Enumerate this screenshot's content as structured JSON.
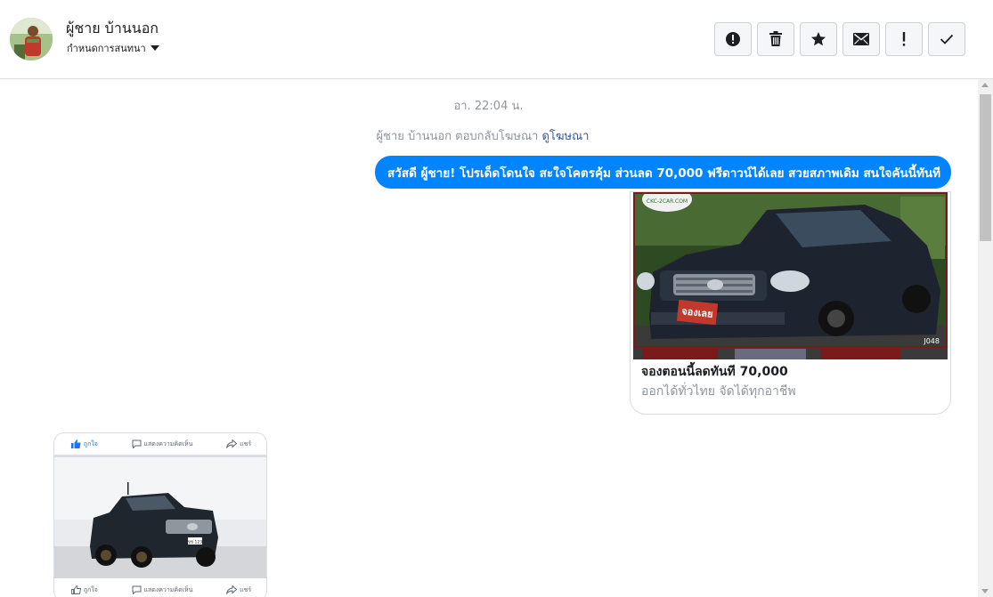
{
  "header": {
    "contact_name": "ผู้ชาย บ้านนอก",
    "conversation_settings": "กำหนดการสนทนา",
    "actions": [
      {
        "icon": "alert-circle-icon",
        "label": "report"
      },
      {
        "icon": "trash-icon",
        "label": "delete"
      },
      {
        "icon": "star-icon",
        "label": "star"
      },
      {
        "icon": "envelope-icon",
        "label": "mark-unread"
      },
      {
        "icon": "exclamation-icon",
        "label": "spam"
      },
      {
        "icon": "check-icon",
        "label": "done"
      }
    ]
  },
  "thread": {
    "timestamp": "อา. 22:04 น.",
    "ad_reply_text": "ผู้ชาย บ้านนอก ตอบกลับโฆษณา",
    "ad_reply_link": "ดูโฆษณา",
    "message": "สวัสดี ผู้ชาย! โปรเด็ดโดนใจ สะใจโคตรคุ้ม ส่วนลด 70,000 ฟรีดาวน์ได้เลย สวยสภาพเดิม สนใจคันนี้ทันที",
    "ad_card": {
      "title": "จองตอนนี้ลดทันที 70,000",
      "subtitle": "ออกได้ทั่วไทย จัดได้ทุกอาชีพ",
      "image_badge": "จองเลย",
      "image_code": "J048",
      "image_logo": "CKC-2CAR.COM"
    },
    "shared_post": {
      "like_label": "ถูกใจ",
      "comment_label": "แสดงความคิดเห็น",
      "share_label": "แชร์",
      "plate": "ขข 123"
    }
  },
  "colors": {
    "accent": "#0084ff",
    "link": "#385898",
    "muted": "#90949c"
  }
}
